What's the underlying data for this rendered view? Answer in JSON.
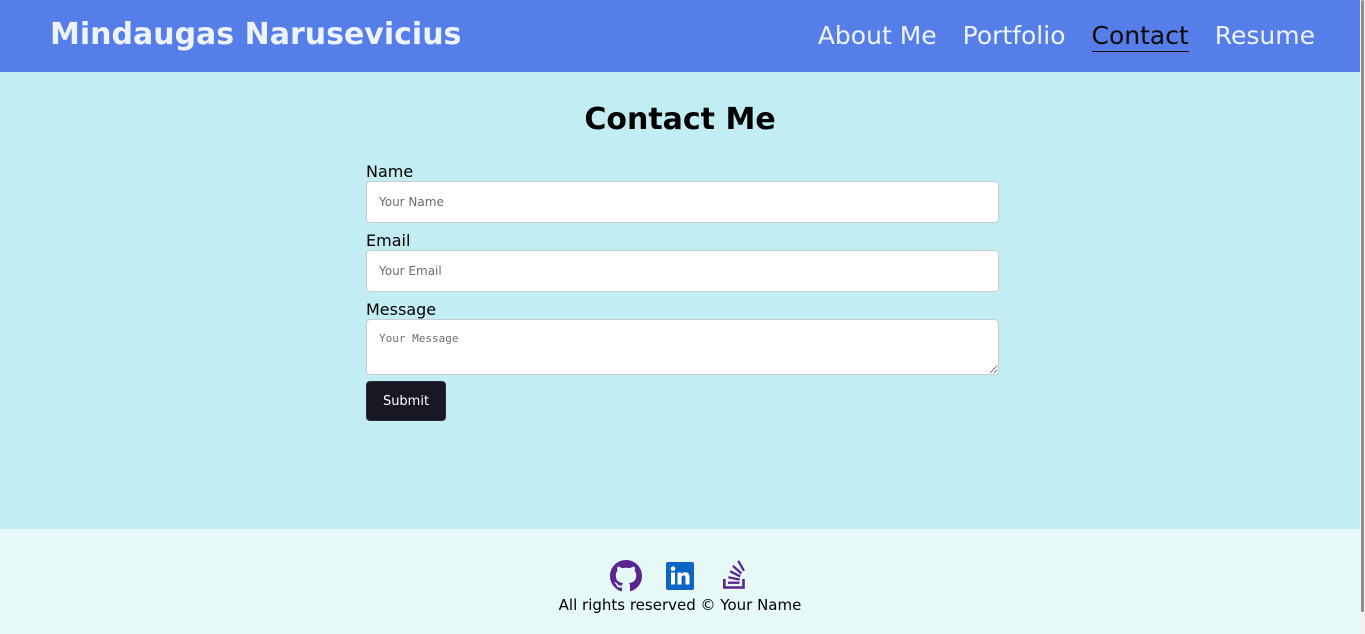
{
  "header": {
    "brand": "Mindaugas Narusevicius",
    "nav": [
      "About Me",
      "Portfolio",
      "Contact",
      "Resume"
    ],
    "active_nav": "Contact"
  },
  "main": {
    "title": "Contact Me",
    "form": {
      "name_label": "Name",
      "name_placeholder": "Your Name",
      "name_value": "",
      "email_label": "Email",
      "email_placeholder": "Your Email",
      "email_value": "",
      "message_label": "Message",
      "message_placeholder": "Your Message",
      "message_value": "",
      "submit_label": "Submit"
    }
  },
  "footer": {
    "icons": [
      "github-icon",
      "linkedin-icon",
      "stack-overflow-icon"
    ],
    "copyright": "All rights reserved © Your Name"
  },
  "colors": {
    "header_bg": "#557ee8",
    "page_bg": "#c2edf2",
    "footer_bg": "#e6f8f8",
    "button_bg": "#171823",
    "icon_purple": "#5b2590",
    "icon_linkedin": "#0a66c2"
  }
}
